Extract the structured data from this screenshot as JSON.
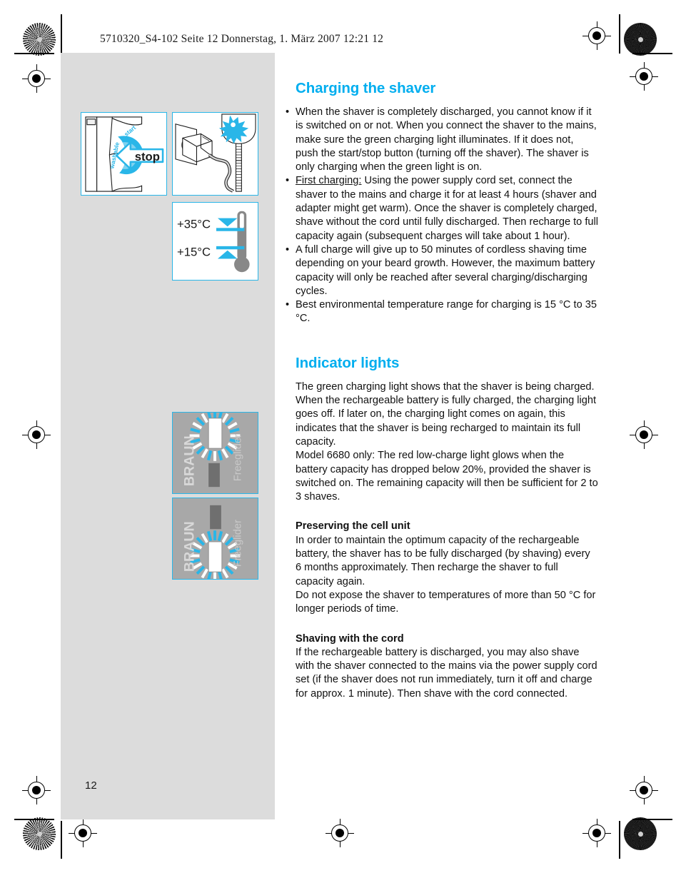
{
  "header": {
    "print_line": "5710320_S4-102  Seite 12  Donnerstag, 1. März 2007  12:21 12"
  },
  "page": {
    "number": "12"
  },
  "colors": {
    "accent_cyan": "#00aeef",
    "figure_border": "#29b6e8",
    "panel_gray": "#dcdcdc",
    "display_gray": "#a8a8a8",
    "body_text": "#111111"
  },
  "figures": {
    "stop_button": {
      "name": "shaver-start-stop-figure",
      "labels": {
        "washable": "washable",
        "start": "start",
        "stop": "stop"
      }
    },
    "plug": {
      "name": "power-supply-cord-figure"
    },
    "temperature": {
      "name": "charging-temperature-range-figure",
      "max_label": "+35°C",
      "min_label": "+15°C"
    },
    "indicator_top": {
      "name": "charging-light-on-figure",
      "brand": "BRAUN",
      "model": "Freeglider"
    },
    "indicator_bottom": {
      "name": "low-charge-light-on-figure",
      "brand": "BRAUN",
      "model": "Freeglider"
    }
  },
  "sections": [
    {
      "id": "charging",
      "title": "Charging the shaver",
      "bullets": [
        {
          "marker": "•",
          "lead": "",
          "text": "When the shaver is completely discharged, you cannot know if it is switched on or not. When you connect the shaver to the mains, make sure the green charging light illuminates. If it does not, push the start/stop button (turning off the shaver). The shaver is only charging when the green light is on."
        },
        {
          "marker": "•",
          "lead": "First charging:",
          "text": "Using the power supply cord set, connect the shaver to the mains and charge it for at least 4 hours (shaver and adapter might get warm). Once the shaver is completely charged, shave without the cord until fully discharged. Then recharge to full capacity again (subsequent charges will take about 1 hour)."
        },
        {
          "marker": "•",
          "lead": "",
          "text": "A full charge will give up to 50 minutes of cordless shaving time depending on your beard growth. However, the maximum battery capacity will only be reached after several charging/discharging cycles."
        },
        {
          "marker": "•",
          "lead": "",
          "text": "Best environmental temperature range for charging is 15 °C to 35 °C."
        }
      ]
    },
    {
      "id": "indicator-lights",
      "title": "Indicator lights",
      "paragraphs": [
        "The green charging light shows that the shaver is being charged. When the rechargeable battery is fully charged, the charging light goes off. If later on, the charging light comes on again, this indicates that the shaver is being recharged to maintain its full capacity.",
        "Model 6680 only: The red low-charge light glows when the battery capacity has dropped below 20%, provided the shaver is switched on. The remaining capacity will then be sufficient for 2 to 3 shaves."
      ],
      "subsections": [
        {
          "heading": "Preserving the cell unit",
          "paragraphs": [
            "In order to maintain the optimum capacity of the rechargeable battery, the shaver has to be fully discharged (by shaving) every 6 months approximately. Then recharge the shaver to full capacity again.",
            "Do not expose the shaver to temperatures of more than 50 °C for longer periods of time."
          ]
        },
        {
          "heading": "Shaving with the cord",
          "paragraphs": [
            "If the rechargeable battery is discharged, you may also shave with the shaver connected to the mains via the power supply cord set (if the shaver does not run immediately, turn it off and charge for approx. 1 minute). Then shave with the cord connected."
          ]
        }
      ]
    }
  ]
}
